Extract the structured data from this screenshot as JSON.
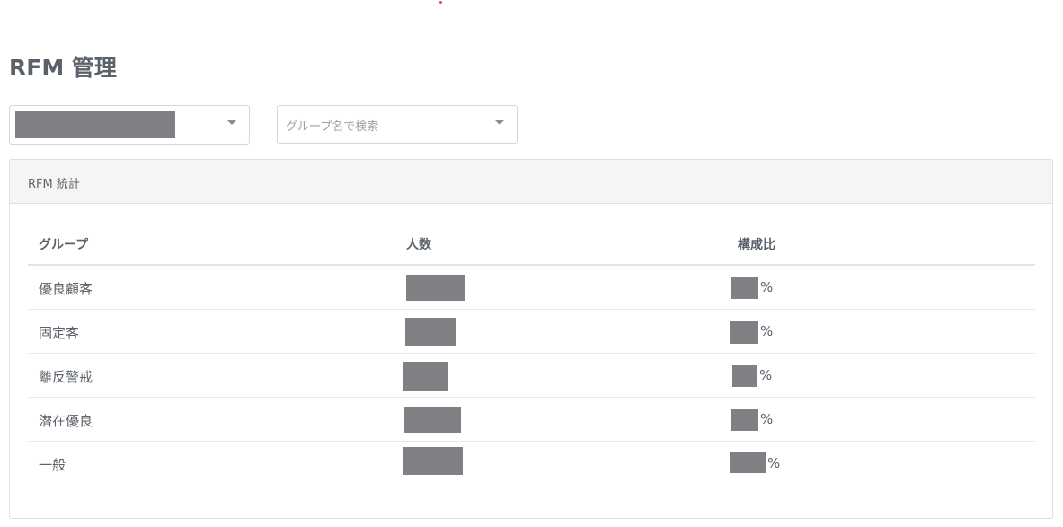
{
  "page": {
    "title": "RFM 管理"
  },
  "filters": {
    "store_select": {
      "value": ""
    },
    "group_select": {
      "placeholder": "グループ名で検索"
    }
  },
  "stats_card": {
    "title": "RFM 統計",
    "columns": {
      "group": "グループ",
      "count": "人数",
      "ratio": "構成比"
    },
    "rows": [
      {
        "group": "優良顧客",
        "count": "",
        "ratio": "",
        "unit": "%"
      },
      {
        "group": "固定客",
        "count": "",
        "ratio": "",
        "unit": "%"
      },
      {
        "group": "離反警戒",
        "count": "",
        "ratio": "",
        "unit": "%"
      },
      {
        "group": "潜在優良",
        "count": "",
        "ratio": "",
        "unit": "%"
      },
      {
        "group": "一般",
        "count": "",
        "ratio": "",
        "unit": "%"
      }
    ]
  },
  "icons": {
    "store_select_caret": "caret-down-icon",
    "group_select_caret": "caret-down-icon"
  },
  "colors": {
    "redaction": "#7f8083",
    "title_text": "#5a6169",
    "card_header_bg": "#f5f5f5"
  }
}
